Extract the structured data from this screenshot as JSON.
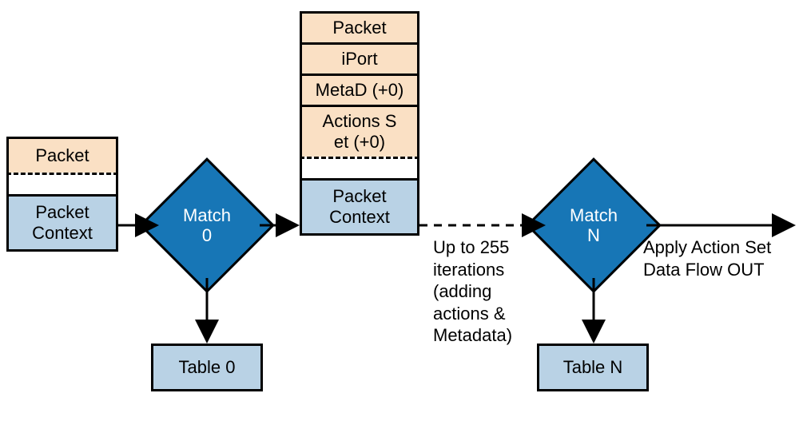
{
  "stack1": {
    "packet": "Packet",
    "context": "Packet\nContext"
  },
  "stack2": {
    "packet": "Packet",
    "iport": "iPort",
    "metad": "MetaD (+0)",
    "actions": "Actions S\net (+0)",
    "context": "Packet\nContext"
  },
  "match0": "Match\n0",
  "matchN": "Match\nN",
  "table0": "Table 0",
  "tableN": "Table N",
  "iterations": "Up to 255\niterations\n(adding\nactions &\nMetadata)",
  "output": "Apply Action Set\nData Flow OUT"
}
